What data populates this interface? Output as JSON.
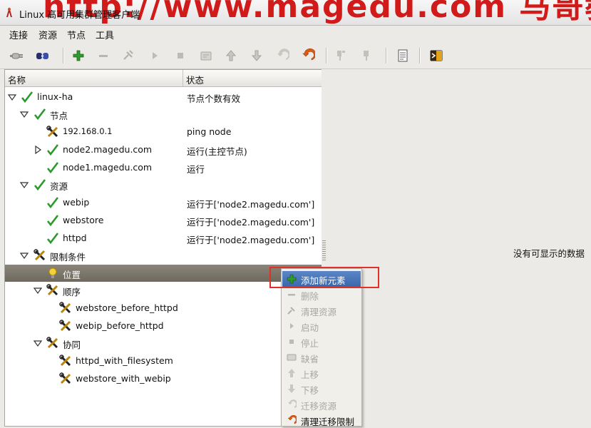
{
  "window": {
    "title": "Linux 高可用集群管理客户端"
  },
  "menu": [
    "连接",
    "资源",
    "节点",
    "工具"
  ],
  "toolbar": {
    "icons": [
      "connect-icon",
      "disconnect-icon",
      "add-icon",
      "remove-icon",
      "cleanup-icon",
      "start-icon",
      "stop-icon",
      "default-icon",
      "move-up-icon",
      "move-down-icon",
      "migrate-icon",
      "clear-migrate-icon",
      "standby-icon",
      "active-icon",
      "view-xml-icon",
      "terminal-icon"
    ]
  },
  "tree": {
    "headers": {
      "name": "名称",
      "status": "状态"
    },
    "rows": [
      {
        "name": "linux-ha",
        "status": "节点个数有效"
      },
      {
        "name": "节点",
        "status": ""
      },
      {
        "name": "192.168.0.1",
        "status": "ping node"
      },
      {
        "name": "node2.magedu.com",
        "status": "运行(主控节点)"
      },
      {
        "name": "node1.magedu.com",
        "status": "运行"
      },
      {
        "name": "资源",
        "status": ""
      },
      {
        "name": "webip",
        "status": "运行于['node2.magedu.com']"
      },
      {
        "name": "webstore",
        "status": "运行于['node2.magedu.com']"
      },
      {
        "name": "httpd",
        "status": "运行于['node2.magedu.com']"
      },
      {
        "name": "限制条件",
        "status": ""
      },
      {
        "name": "位置",
        "status": ""
      },
      {
        "name": "顺序",
        "status": ""
      },
      {
        "name": "webstore_before_httpd",
        "status": ""
      },
      {
        "name": "webip_before_httpd",
        "status": ""
      },
      {
        "name": "协同",
        "status": ""
      },
      {
        "name": "httpd_with_filesystem",
        "status": ""
      },
      {
        "name": "webstore_with_webip",
        "status": ""
      }
    ]
  },
  "right_pane": {
    "empty_text": "没有可显示的数据"
  },
  "context_menu": {
    "items": [
      "添加新元素",
      "删除",
      "清理资源",
      "启动",
      "停止",
      "缺省",
      "上移",
      "下移",
      "迁移资源",
      "清理迁移限制"
    ]
  },
  "colors": {
    "highlight": "#3a68ad",
    "annotation": "#e0302a",
    "check": "#2a9a2a"
  }
}
